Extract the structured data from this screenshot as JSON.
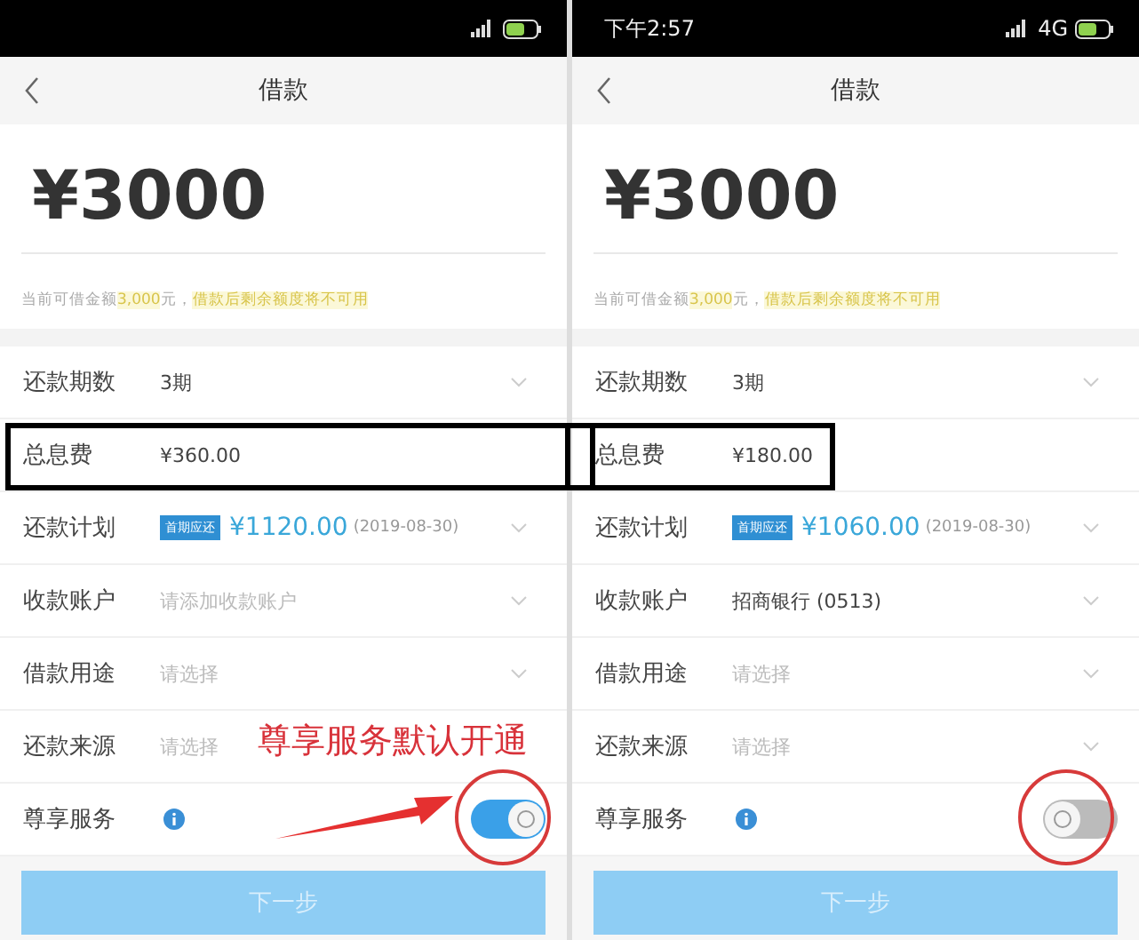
{
  "phones": [
    {
      "nav": {
        "title": "借款"
      },
      "amount": "¥3000",
      "note": [
        {
          "text": "当前可借金额",
          "highlight": false
        },
        {
          "text": "3,000",
          "highlight": true
        },
        {
          "text": "元，",
          "highlight": false
        },
        {
          "text": "借款后剩余额度将不可用",
          "highlight": true
        }
      ],
      "rows": [
        {
          "kind": "select",
          "label": "还款期数",
          "value": "3期"
        },
        {
          "kind": "plain",
          "label": "总息费",
          "value": "¥360.00"
        },
        {
          "kind": "plan",
          "label": "还款计划",
          "tag": "首期应还",
          "value": "¥1120.00",
          "date": "(2019-08-30)"
        },
        {
          "kind": "select",
          "label": "收款账户",
          "placeholder": "请添加收款账户"
        },
        {
          "kind": "select",
          "label": "借款用途",
          "placeholder": "请选择"
        },
        {
          "kind": "select",
          "label": "还款来源",
          "placeholder": "请选择",
          "chevron": false
        },
        {
          "kind": "toggle",
          "label": "尊享服务",
          "on": true
        }
      ],
      "button": {
        "label": "下一步",
        "disabled": true
      }
    },
    {
      "status_bar": {
        "time": "下午2:57",
        "network": "4G"
      },
      "nav": {
        "title": "借款"
      },
      "amount": "¥3000",
      "note": [
        {
          "text": "当前可借金额",
          "highlight": false
        },
        {
          "text": "3,000",
          "highlight": true
        },
        {
          "text": "元，",
          "highlight": false
        },
        {
          "text": "借款后剩余额度将不可用",
          "highlight": true
        }
      ],
      "rows": [
        {
          "kind": "select",
          "label": "还款期数",
          "value": "3期"
        },
        {
          "kind": "plain",
          "label": "总息费",
          "value": "¥180.00"
        },
        {
          "kind": "plan",
          "label": "还款计划",
          "tag": "首期应还",
          "value": "¥1060.00",
          "date": "(2019-08-30)"
        },
        {
          "kind": "select",
          "label": "收款账户",
          "value": "招商银行 (0513)"
        },
        {
          "kind": "select",
          "label": "借款用途",
          "placeholder": "请选择"
        },
        {
          "kind": "select",
          "label": "还款来源",
          "placeholder": "请选择"
        },
        {
          "kind": "toggle",
          "label": "尊享服务",
          "on": false
        }
      ],
      "button": {
        "label": "下一步",
        "disabled": true
      }
    }
  ],
  "annotation": {
    "caption": "尊享服务默认开通"
  }
}
